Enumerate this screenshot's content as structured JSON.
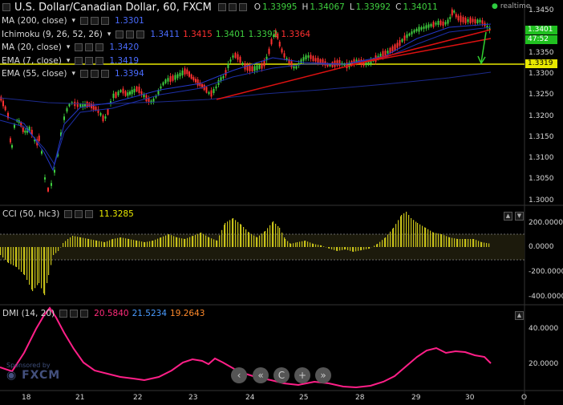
{
  "header": {
    "symbol": "U.S. Dollar/Canadian Dollar, 60, FXCM",
    "o_label": "O",
    "o_value": "1.33995",
    "h_label": "H",
    "h_value": "1.34067",
    "l_label": "L",
    "l_value": "1.33992",
    "c_label": "C",
    "c_value": "1.34011",
    "realtime": "realtime"
  },
  "indicators": [
    {
      "name": "MA (200, close)",
      "values": [
        {
          "text": "1.3301",
          "color": "#4a6cff"
        }
      ]
    },
    {
      "name": "Ichimoku (9, 26, 52, 26)",
      "values": [
        {
          "text": "1.3411",
          "color": "#4a6cff"
        },
        {
          "text": "1.3415",
          "color": "#ff3030"
        },
        {
          "text": "1.3401",
          "color": "#3fd03f"
        },
        {
          "text": "1.3392",
          "color": "#3fd03f"
        },
        {
          "text": "1.3364",
          "color": "#ff3030"
        }
      ]
    },
    {
      "name": "MA (20, close)",
      "values": [
        {
          "text": "1.3420",
          "color": "#4a6cff"
        }
      ]
    },
    {
      "name": "EMA (7, close)",
      "values": [
        {
          "text": "1.3419",
          "color": "#4a6cff"
        }
      ]
    },
    {
      "name": "EMA (55, close)",
      "values": [
        {
          "text": "1.3394",
          "color": "#4a6cff"
        }
      ]
    }
  ],
  "price_axis": [
    "1.3450",
    "1.3400",
    "1.3350",
    "1.3300",
    "1.3250",
    "1.3200",
    "1.3150",
    "1.3100",
    "1.3050",
    "1.3000"
  ],
  "price_tags": {
    "current": "1.3401",
    "timer": "47:52",
    "level": "1.3319"
  },
  "cci": {
    "label": "CCI (50, hlc3)",
    "value": "11.3285",
    "value_color": "#e8e800",
    "axis": [
      "200.0000",
      "0.0000",
      "-200.0000",
      "-400.0000"
    ]
  },
  "dmi": {
    "label": "DMI (14, 20)",
    "values": [
      {
        "text": "20.5840",
        "color": "#ff2b7a"
      },
      {
        "text": "21.5234",
        "color": "#4a9cff"
      },
      {
        "text": "19.2643",
        "color": "#ff8a2b"
      }
    ],
    "axis": [
      "40.0000",
      "20.0000"
    ]
  },
  "x_axis": [
    "18",
    "21",
    "22",
    "23",
    "24",
    "25",
    "28",
    "29",
    "30",
    "O"
  ],
  "sponsor": {
    "text": "Sponsored by",
    "brand": "FXCM"
  },
  "controls": {
    "prev": "‹",
    "back": "«",
    "reset": "C",
    "zoom_in": "+",
    "next": "»"
  },
  "colors": {
    "up_candle": "#3fd03f",
    "down_candle": "#ff3030",
    "trendline": "#dd1111",
    "support": "#e8e800",
    "ma": "#1c2a8c",
    "cci_bar": "#c8c21a",
    "dmi": "#ff1f88",
    "arrow": "#30d030",
    "background": "#000000"
  }
}
